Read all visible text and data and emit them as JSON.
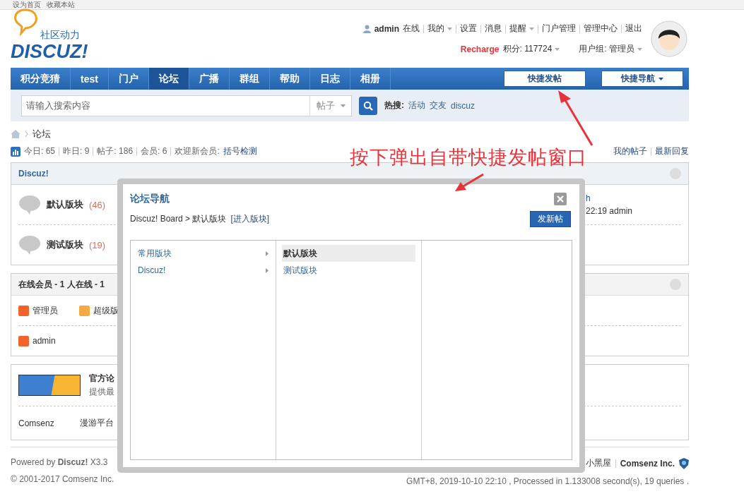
{
  "top_bar": {
    "links": [
      "设为首页",
      "收藏本站"
    ]
  },
  "logo": {
    "tagline": "社区动力",
    "wordmark": "DISCUZ!"
  },
  "user_bar": {
    "name": "admin",
    "status": "在线",
    "links": [
      {
        "label": "我的",
        "dropdown": true
      },
      {
        "label": "设置",
        "dropdown": false
      },
      {
        "label": "消息",
        "dropdown": false
      },
      {
        "label": "提醒",
        "dropdown": true
      },
      {
        "label": "门户管理",
        "dropdown": false
      },
      {
        "label": "管理中心",
        "dropdown": false
      },
      {
        "label": "退出",
        "dropdown": false
      }
    ],
    "recharge": "Recharge",
    "credits": "积分: 117724",
    "group": "用户组: 管理员"
  },
  "nav": {
    "items": [
      {
        "label": "积分竞猜",
        "selected": false
      },
      {
        "label": "test",
        "selected": false
      },
      {
        "label": "门户",
        "selected": false
      },
      {
        "label": "论坛",
        "selected": true
      },
      {
        "label": "广播",
        "selected": false
      },
      {
        "label": "群组",
        "selected": false
      },
      {
        "label": "帮助",
        "selected": false
      },
      {
        "label": "日志",
        "selected": false
      },
      {
        "label": "相册",
        "selected": false
      }
    ],
    "buttons": [
      {
        "label": "快捷发帖",
        "dropdown": false
      },
      {
        "label": "快捷导航",
        "dropdown": true
      }
    ]
  },
  "search": {
    "placeholder": "请输入搜索内容",
    "type": "帖子",
    "hot_label": "热搜:",
    "hot": [
      "活动",
      "交友",
      "discuz"
    ]
  },
  "breadcrumb": [
    "论坛"
  ],
  "stats": {
    "items": [
      {
        "label": "今日:",
        "value": "65"
      },
      {
        "label": "昨日:",
        "value": "9"
      },
      {
        "label": "帖子:",
        "value": "186"
      },
      {
        "label": "会员:",
        "value": "6"
      }
    ],
    "welcome_label": "欢迎新会员:",
    "new_member": "括号检测",
    "links": [
      "我的帖子",
      "最新回复"
    ]
  },
  "forum_section": {
    "title": "Discuz!",
    "forums": [
      {
        "name": "默认版块",
        "count": "(46)"
      },
      {
        "name": "测试版块",
        "count": "(19)"
      }
    ],
    "last_post": [
      "h",
      "22:19 admin"
    ]
  },
  "online": {
    "title": "在线会员 - 1 人在线 - 1",
    "legend": [
      {
        "label": "管理员",
        "color": "#f0642b"
      },
      {
        "label": "超级版",
        "color": "#f5a843"
      }
    ],
    "members": [
      {
        "name": "admin",
        "color": "#f0642b"
      }
    ]
  },
  "links": {
    "featured_title": "官方论",
    "featured_desc": "提供最",
    "text_links": [
      "Comsenz",
      "漫游平台"
    ]
  },
  "footer": {
    "powered": "Powered by **Discuz!** X3.3",
    "copyright": "© 2001-2017 Comsenz Inc.",
    "links": [
      "小黑屋",
      "Comsenz Inc."
    ],
    "stats_line": "GMT+8, 2019-10-10 22:10 , Processed in 1.133008 second(s), 19 queries ."
  },
  "dialog": {
    "title": "论坛导航",
    "breadcrumb": "Discuz! Board > 默认版块",
    "enter_link": "[进入版块]",
    "post_button": "发新帖",
    "groups": [
      {
        "label": "常用版块",
        "selected": false
      },
      {
        "label": "Discuz!",
        "selected": false
      }
    ],
    "forums": [
      {
        "label": "默认版块",
        "selected": true
      },
      {
        "label": "测试版块",
        "selected": false
      }
    ]
  },
  "annotation": {
    "text": "按下弹出自带快捷发帖窗口"
  }
}
